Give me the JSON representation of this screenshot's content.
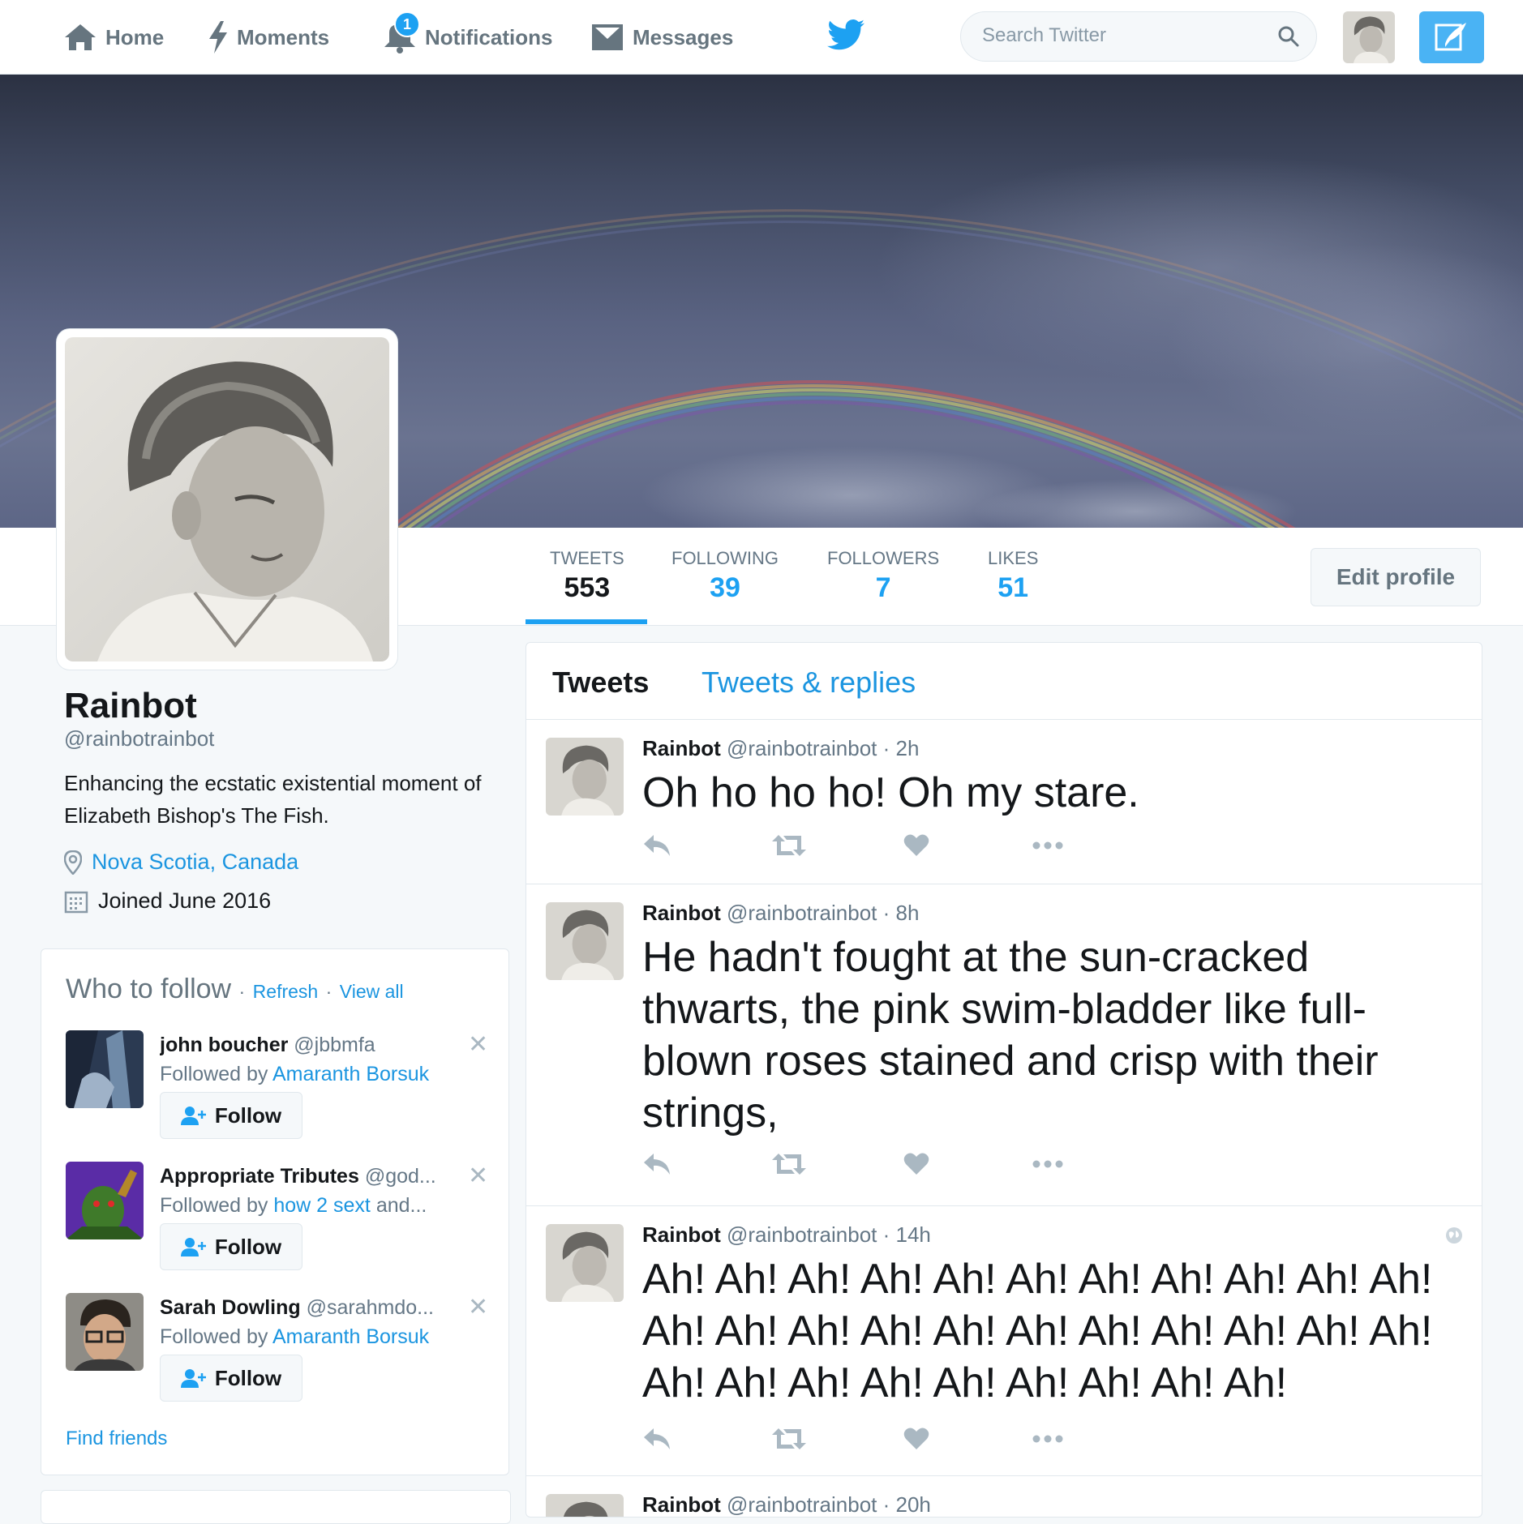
{
  "nav": {
    "home": "Home",
    "moments": "Moments",
    "notifications": "Notifications",
    "notifications_count": "1",
    "messages": "Messages",
    "search_placeholder": "Search Twitter"
  },
  "profile": {
    "name": "Rainbot",
    "handle": "@rainbotrainbot",
    "bio": "Enhancing the ecstatic existential moment of Elizabeth Bishop's The Fish.",
    "location": "Nova Scotia, Canada",
    "joined": "Joined June 2016",
    "edit_label": "Edit profile"
  },
  "stats": [
    {
      "label": "TWEETS",
      "value": "553"
    },
    {
      "label": "FOLLOWING",
      "value": "39"
    },
    {
      "label": "FOLLOWERS",
      "value": "7"
    },
    {
      "label": "LIKES",
      "value": "51"
    }
  ],
  "who_to_follow": {
    "title": "Who to follow",
    "sep": "·",
    "refresh": "Refresh",
    "view_all": "View all",
    "follow_label": "Follow",
    "followed_by": "Followed by",
    "find_friends": "Find friends",
    "items": [
      {
        "name": "john boucher",
        "handle": "@jbbmfa",
        "followed_by": "Amaranth Borsuk",
        "followed_extra": ""
      },
      {
        "name": "Appropriate Tributes",
        "handle": "@god...",
        "followed_by": "how 2 sext",
        "followed_extra": "and..."
      },
      {
        "name": "Sarah Dowling",
        "handle": "@sarahmdo...",
        "followed_by": "Amaranth Borsuk",
        "followed_extra": ""
      }
    ]
  },
  "timeline": {
    "tab_tweets": "Tweets",
    "tab_replies": "Tweets & replies",
    "tweets": [
      {
        "name": "Rainbot",
        "meta": "@rainbotrainbot · 2h",
        "text": "Oh ho ho ho! Oh my stare."
      },
      {
        "name": "Rainbot",
        "meta": "@rainbotrainbot · 8h",
        "text": "He hadn't fought at the sun-cracked thwarts, the pink swim-bladder like full-blown roses stained and crisp with their strings,"
      },
      {
        "name": "Rainbot",
        "meta": "@rainbotrainbot · 14h",
        "text": "Ah! Ah! Ah! Ah! Ah! Ah! Ah! Ah! Ah! Ah! Ah! Ah! Ah! Ah! Ah! Ah! Ah! Ah! Ah! Ah! Ah! Ah! Ah! Ah! Ah! Ah! Ah! Ah! Ah! Ah! Ah!"
      },
      {
        "name": "Rainbot",
        "meta": "@rainbotrainbot · 20h",
        "text": ""
      }
    ]
  },
  "colors": {
    "accent": "#1da1f2",
    "link": "#1b95e0",
    "text": "#14171a",
    "muted": "#657786",
    "background": "#f5f8fa"
  }
}
